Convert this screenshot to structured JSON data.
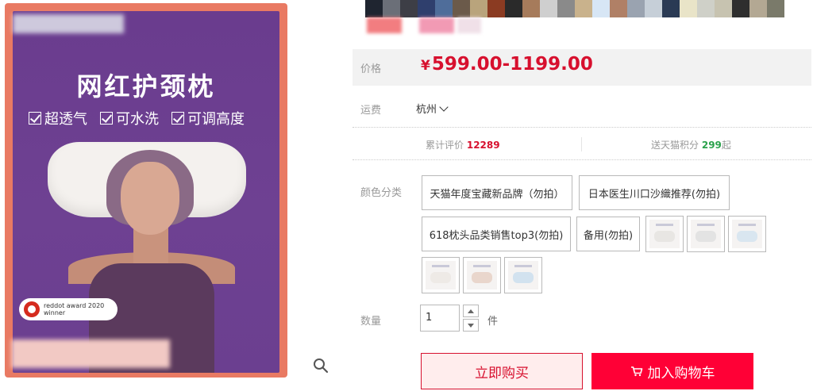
{
  "product_image": {
    "headline": "网红护颈枕",
    "features": [
      "超透气",
      "可水洗",
      "可调高度"
    ],
    "award_line1": "reddot award 2020",
    "award_line2": "winner"
  },
  "swatch_colors": [
    "#1f2530",
    "#6b6f78",
    "#3d3e46",
    "#2f3f6d",
    "#4f6d9a",
    "#6b5a4a",
    "#b9a47c",
    "#8b3b22",
    "#2a2a2a",
    "#a67b5b",
    "#cfcfcf",
    "#8a8a8a",
    "#c9b28c",
    "#d7e6f5",
    "#b08066",
    "#9aa3b0",
    "#c6cfd8",
    "#2a3a54",
    "#e9e4c8",
    "#cfd0c8",
    "#c7c3b0",
    "#2e2e2e",
    "#b3a893",
    "#7a7a6a"
  ],
  "price": {
    "label": "价格",
    "currency": "¥",
    "value": "599.00-1199.00",
    "color": "#d7102e"
  },
  "shipping": {
    "label": "运费",
    "city": "杭州"
  },
  "stats": {
    "review_label": "累计评价",
    "review_count": "12289",
    "points_label": "送天猫积分",
    "points_value": "299",
    "points_suffix": "起"
  },
  "color_category": {
    "label": "颜色分类",
    "options": [
      "天猫年度宝藏新品牌（勿拍）",
      "日本医生川口沙織推荐(勿拍)",
      "618枕头品类销售top3(勿拍)",
      "备用(勿拍)"
    ]
  },
  "quantity": {
    "label": "数量",
    "value": "1",
    "unit": "件"
  },
  "buttons": {
    "buy_now": "立即购买",
    "add_to_cart": "加入购物车",
    "primary_color": "#ff0036"
  }
}
